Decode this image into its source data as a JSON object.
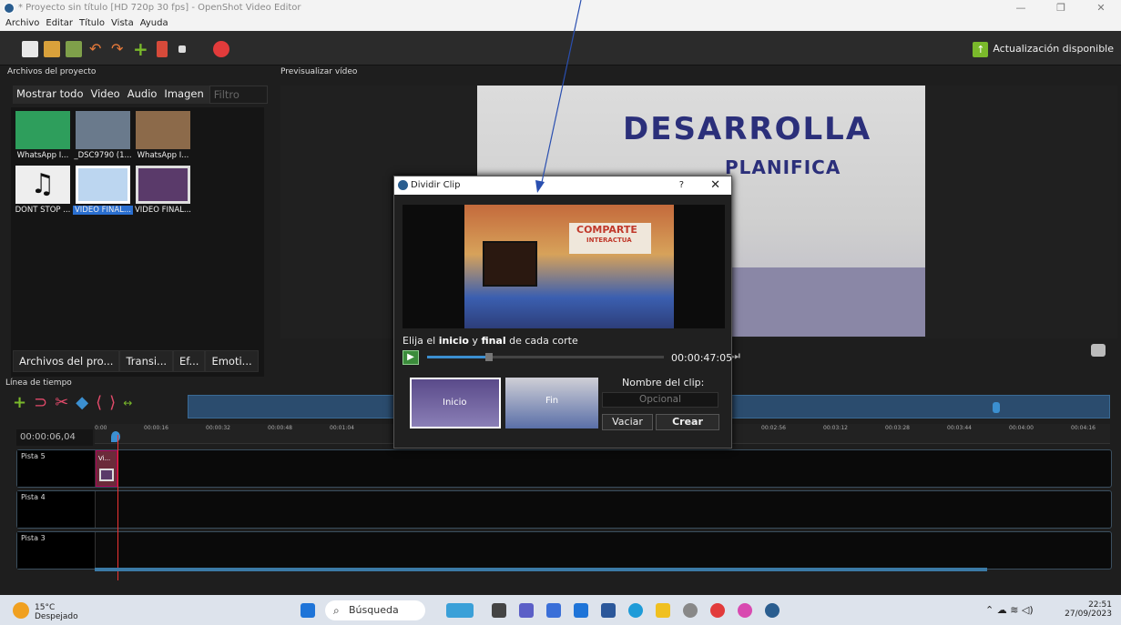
{
  "window": {
    "title": "* Proyecto sin título [HD 720p 30 fps] - OpenShot Video Editor"
  },
  "menu": [
    "Archivo",
    "Editar",
    "Título",
    "Vista",
    "Ayuda"
  ],
  "toolbar": {
    "update_label": "Actualización disponible"
  },
  "project_files": {
    "header": "Archivos del proyecto",
    "filters": [
      "Mostrar todo",
      "Video",
      "Audio",
      "Imagen"
    ],
    "filter_placeholder": "Filtro",
    "files": [
      {
        "label": "WhatsApp I...",
        "color": "#2e9e5c"
      },
      {
        "label": "_DSC9790 (1...",
        "color": "#6a7a8c"
      },
      {
        "label": "WhatsApp I...",
        "color": "#8c6a4a"
      },
      {
        "label": "DONT STOP ...",
        "color": "#eeeeee"
      },
      {
        "label": "VIDEO FINAL...",
        "color": "#bcd6f0"
      },
      {
        "label": "VIDEO FINAL...",
        "color": "#5a3a6a"
      }
    ],
    "bottom_tabs": [
      "Archivos del pro...",
      "Transi...",
      "Ef...",
      "Emoti..."
    ]
  },
  "preview": {
    "header": "Previsualizar vídeo",
    "frame_text_1": "DESARROLLA",
    "frame_text_2": "PLANIFICA"
  },
  "timeline": {
    "header": "Línea de tiempo",
    "timecode": "00:00:06,04",
    "ruler_labels": [
      "0:00",
      "00:00:16",
      "00:00:32",
      "00:00:48",
      "00:01:04",
      "00:02:56",
      "00:03:12",
      "00:03:28",
      "00:03:44",
      "00:04:00",
      "00:04:16"
    ],
    "tracks": [
      "Pista 5",
      "Pista 4",
      "Pista 3"
    ],
    "clip_label": "Vi..."
  },
  "dialog": {
    "title": "Dividir Clip",
    "help": "?",
    "frame_text_1": "COMPARTE",
    "frame_text_2": "INTERACTUA",
    "choose_prefix": "Elija el ",
    "choose_start": "inicio",
    "choose_mid": " y ",
    "choose_end": "final",
    "choose_suffix": " de cada corte",
    "time": "00:00:47:05",
    "position_fraction": 0.25,
    "start_label": "Inicio",
    "end_label": "Fin",
    "clip_name_label": "Nombre del clip:",
    "clip_name_placeholder": "Opcional",
    "clear_button": "Vaciar",
    "create_button": "Crear"
  },
  "taskbar": {
    "temp": "15°C",
    "weather": "Despejado",
    "search": "Búsqueda",
    "time": "22:51",
    "date": "27/09/2023"
  }
}
